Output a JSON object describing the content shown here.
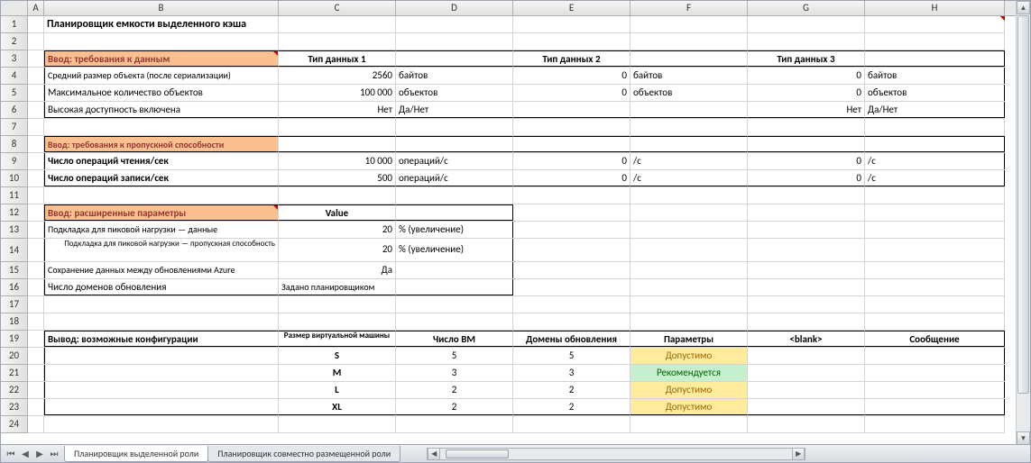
{
  "cols": [
    "A",
    "B",
    "C",
    "D",
    "E",
    "F",
    "G",
    "H"
  ],
  "title": "Планировщик емкости выделенного кэша",
  "sec1": {
    "header": "Ввод: требования к данным",
    "dtype1": "Тип данных 1",
    "dtype2": "Тип данных 2",
    "dtype3": "Тип данных 3",
    "r4_label": "Средний размер объекта (после сериализации)",
    "r4_c": "2560",
    "r4_d": "байтов",
    "r4_e": "0",
    "r4_f": "байтов",
    "r4_g": "0",
    "r4_h": "байтов",
    "r5_label": "Максимальное количество объектов",
    "r5_c": "100 000",
    "r5_d": "объектов",
    "r5_e": "0",
    "r5_f": "объектов",
    "r5_g": "0",
    "r5_h": "объектов",
    "r6_label": "Высокая доступность включена",
    "r6_c": "Нет",
    "r6_d": "Да/Нет",
    "r6_g": "Нет",
    "r6_h": "Да/Нет"
  },
  "sec2": {
    "header": "Ввод: требования к пропускной способности",
    "r9_label": "Число операций чтения/сек",
    "r9_c": "10 000",
    "r9_d": "операций/с",
    "r9_e": "0",
    "r9_f": "/с",
    "r9_g": "0",
    "r9_h": "/с",
    "r10_label": "Число операций записи/сек",
    "r10_c": "500",
    "r10_d": "операций/с",
    "r10_e": "0",
    "r10_f": "/с",
    "r10_g": "0",
    "r10_h": "/с"
  },
  "sec3": {
    "header": "Ввод: расширенные параметры",
    "value": "Value",
    "r13_label": "Подкладка для пиковой нагрузки — данные",
    "r13_c": "20",
    "r13_d": "% (увеличение)",
    "r14_label": "Подкладка для пиковой нагрузки — пропускная способность",
    "r14_c": "20",
    "r14_d": "% (увеличение)",
    "r15_label": "Сохранение данных между обновлениями Azure",
    "r15_c": "Да",
    "r16_label": "Число доменов обновления",
    "r16_c": "Задано планировщиком"
  },
  "out": {
    "header": "Вывод: возможные конфигурации",
    "h_c": "Размер виртуальной машины",
    "h_d": "Число ВМ",
    "h_e": "Домены обновления",
    "h_f": "Параметры",
    "h_g": "<blank>",
    "h_h": "Сообщение",
    "rows": [
      {
        "size": "S",
        "vm": "5",
        "dom": "5",
        "stat": "Допустимо",
        "statcls": "status-ok"
      },
      {
        "size": "M",
        "vm": "3",
        "dom": "3",
        "stat": "Рекомендуется",
        "statcls": "status-rec"
      },
      {
        "size": "L",
        "vm": "2",
        "dom": "2",
        "stat": "Допустимо",
        "statcls": "status-ok"
      },
      {
        "size": "XL",
        "vm": "2",
        "dom": "2",
        "stat": "Допустимо",
        "statcls": "status-ok"
      }
    ]
  },
  "tabs": {
    "active": "Планировщик выделенной роли",
    "other": "Планировщик совместно размещенной роли"
  }
}
